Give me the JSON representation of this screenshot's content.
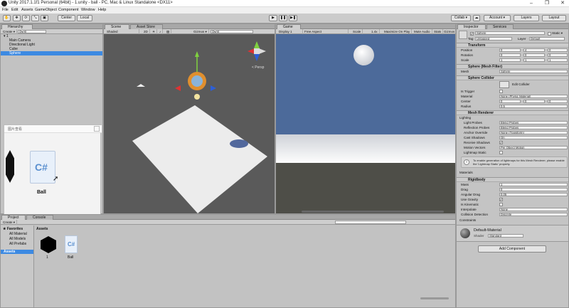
{
  "window": {
    "title": "Unity 2017.1.1f1 Personal (64bit) - 1.unity - ball - PC, Mac & Linux Standalone <DX11>",
    "min": "–",
    "max": "❐",
    "close": "✕"
  },
  "menu": [
    "File",
    "Edit",
    "Assets",
    "GameObject",
    "Component",
    "Window",
    "Help"
  ],
  "toolbar": {
    "center": "Center",
    "local": "Local",
    "collab": "Collab ▾",
    "account": "Account ▾",
    "layers": "Layers",
    "layout": "Layout"
  },
  "hierarchy": {
    "tab": "Hierarchy",
    "create": "Create ▾",
    "search": "Q▾All",
    "scene": "1",
    "items": [
      "Main Camera",
      "Directional Light",
      "Cube",
      "Sphere"
    ],
    "selected": 3
  },
  "floating": {
    "title": "图片查看"
  },
  "scene": {
    "tab": "Scene",
    "asset_tab": "Asset Store",
    "shaded": "Shaded",
    "mode2d": "2D",
    "gizmos": "Gizmos ▾",
    "search": "Q▾All",
    "persp": "< Persp"
  },
  "game": {
    "tab": "Game",
    "display": "Display 1",
    "aspect": "Free Aspect",
    "scale_label": "Scale",
    "scale_value": "1.4x",
    "maximize": "Maximize On Play",
    "mute": "Mute Audio",
    "stats": "Stats",
    "gizmos": "Gizmos ▾"
  },
  "inspector": {
    "tab": "Inspector",
    "services_tab": "Services",
    "name": "Sphere",
    "static": "Static ▾",
    "tag_label": "Tag",
    "tag": "Untagged",
    "layer_label": "Layer",
    "layer": "Default",
    "transform": {
      "title": "Transform",
      "rows": [
        {
          "label": "Position",
          "x": "0",
          "y": "4",
          "z": "0"
        },
        {
          "label": "Rotation",
          "x": "0",
          "y": "0",
          "z": "0"
        },
        {
          "label": "Scale",
          "x": "1",
          "y": "1",
          "z": "1"
        }
      ]
    },
    "mesh_filter": {
      "title": "Sphere (Mesh Filter)",
      "mesh_label": "Mesh",
      "mesh": "Sphere"
    },
    "collider": {
      "title": "Sphere Collider",
      "edit": "Edit Collider",
      "trigger": "Is Trigger",
      "material_label": "Material",
      "material": "None (Physic Material)",
      "center_label": "Center",
      "cx": "0",
      "cy": "0",
      "cz": "0",
      "radius_label": "Radius",
      "radius": "0.5"
    },
    "renderer": {
      "title": "Mesh Renderer",
      "lighting": "Lighting",
      "rows": [
        {
          "label": "Light Probes",
          "value": "Blend Probes"
        },
        {
          "label": "Reflection Probes",
          "value": "Blend Probes"
        },
        {
          "label": "Anchor Override",
          "value": "None (Transform)"
        },
        {
          "label": "Cast Shadows",
          "value": "On"
        },
        {
          "label": "Receive Shadows",
          "value": "✔"
        },
        {
          "label": "Motion Vectors",
          "value": "Per Object Motion"
        },
        {
          "label": "Lightmap Static",
          "value": ""
        }
      ],
      "info": "To enable generation of lightmaps for this Mesh Renderer, please enable the 'Lightmap Static' property."
    },
    "materials": "Materials",
    "rigidbody": {
      "title": "Rigidbody",
      "rows": [
        {
          "label": "Mass",
          "value": "1"
        },
        {
          "label": "Drag",
          "value": "0"
        },
        {
          "label": "Angular Drag",
          "value": "0.05"
        },
        {
          "label": "Use Gravity",
          "value": "✔"
        },
        {
          "label": "Is Kinematic",
          "value": ""
        },
        {
          "label": "Interpolate",
          "value": "None"
        },
        {
          "label": "Collision Detection",
          "value": "Discrete"
        }
      ]
    },
    "constraints": "Constraints",
    "material_name": "Default-Material",
    "shader_label": "Shader",
    "shader": "Standard",
    "add_component": "Add Component"
  },
  "project": {
    "tab": "Project",
    "console_tab": "Console",
    "create": "Create ▾",
    "favorites": "Favorites",
    "fav_items": [
      "All Material",
      "All Models",
      "All Prefabs"
    ],
    "assets": "Assets",
    "breadcrumb": "Assets",
    "files": [
      {
        "name": "1",
        "icon": "unity-icon"
      },
      {
        "name": "Ball",
        "icon": "csharp-icon"
      }
    ]
  },
  "preview": {
    "file": "Ball"
  }
}
